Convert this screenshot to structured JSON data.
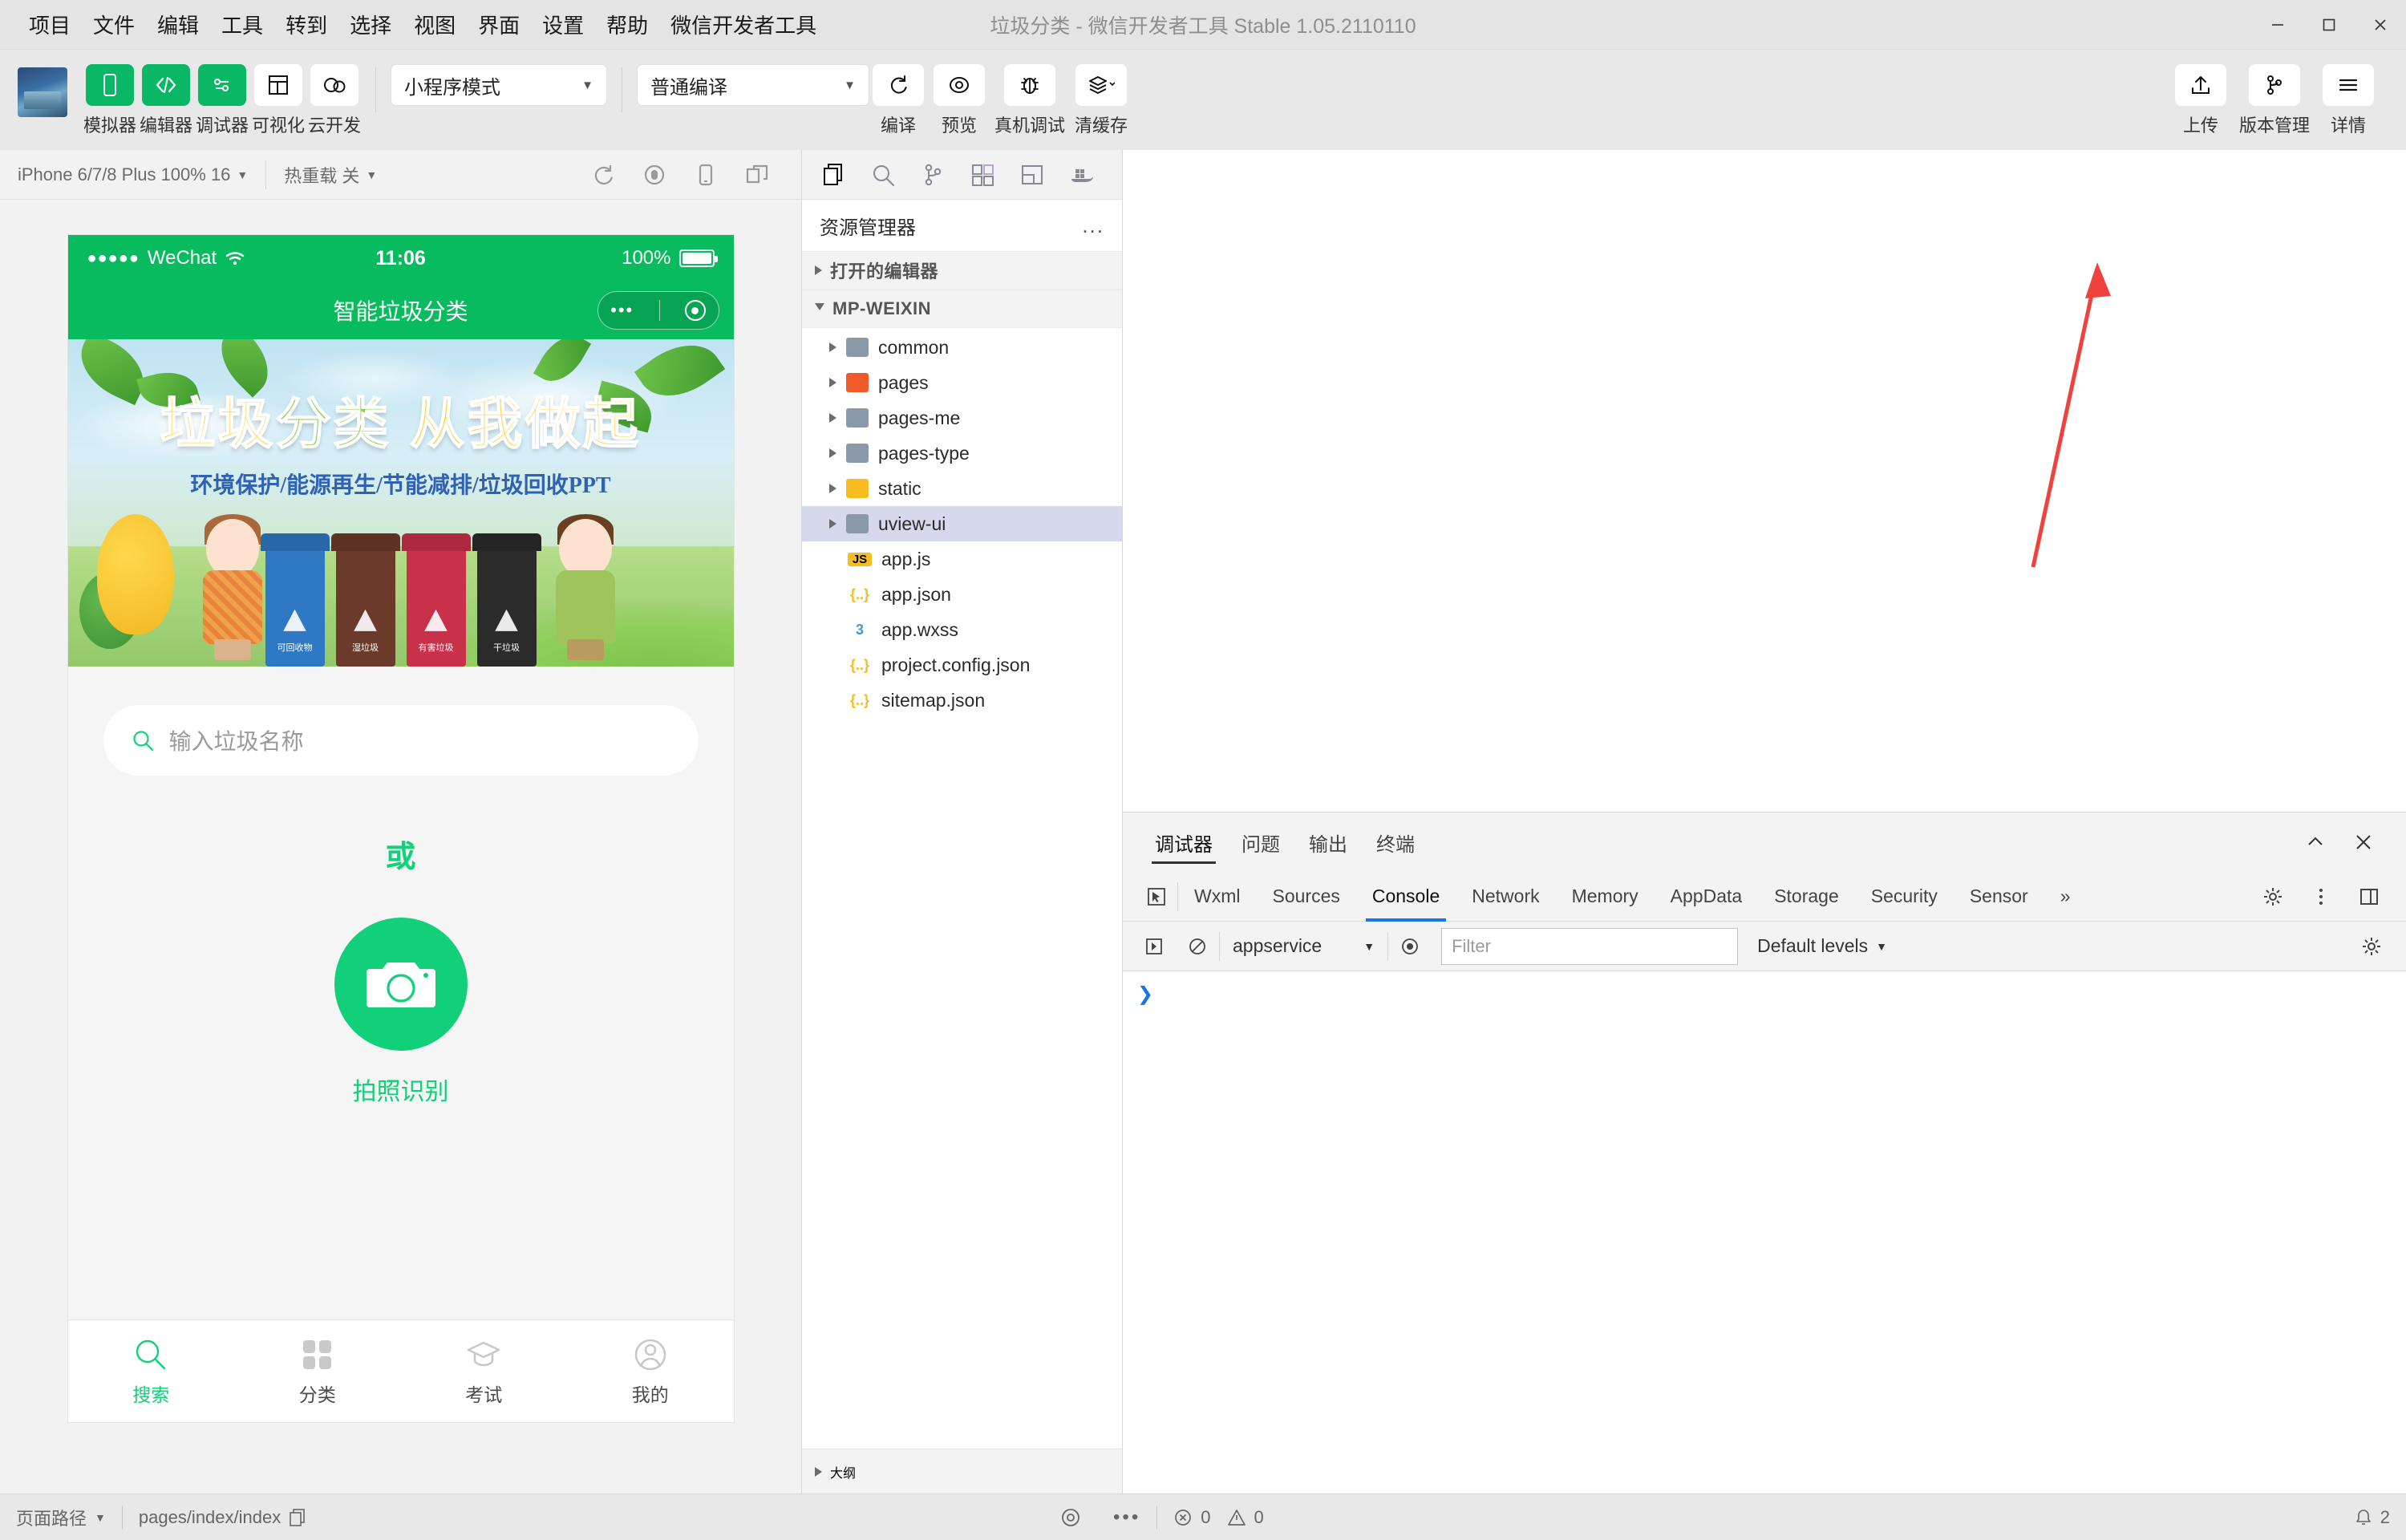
{
  "window": {
    "title": "垃圾分类 - 微信开发者工具 Stable 1.05.2110110",
    "minimize": "minimize-icon",
    "maximize": "maximize-icon",
    "close": "close-icon"
  },
  "menu": {
    "items": [
      "项目",
      "文件",
      "编辑",
      "工具",
      "转到",
      "选择",
      "视图",
      "界面",
      "设置",
      "帮助",
      "微信开发者工具"
    ]
  },
  "toolbar": {
    "panels": [
      {
        "label": "模拟器",
        "icon": "phone-icon",
        "active": true
      },
      {
        "label": "编辑器",
        "icon": "code-icon",
        "active": true
      },
      {
        "label": "调试器",
        "icon": "sliders-icon",
        "active": true
      },
      {
        "label": "可视化",
        "icon": "layout-icon",
        "active": false
      },
      {
        "label": "云开发",
        "icon": "cloud-icon",
        "active": false
      }
    ],
    "mode_select": {
      "value": "小程序模式",
      "caret": "chevron-down-icon"
    },
    "compile_select": {
      "value": "普通编译",
      "caret": "chevron-down-icon"
    },
    "actions": [
      {
        "label": "编译",
        "icon": "refresh-icon"
      },
      {
        "label": "预览",
        "icon": "eye-icon"
      },
      {
        "label": "真机调试",
        "icon": "bug-icon"
      },
      {
        "label": "清缓存",
        "icon": "layers-icon"
      }
    ],
    "right_actions": [
      {
        "label": "上传",
        "icon": "upload-icon"
      },
      {
        "label": "版本管理",
        "icon": "branch-icon"
      },
      {
        "label": "详情",
        "icon": "menu-icon"
      }
    ]
  },
  "simulator": {
    "device_select": "iPhone 6/7/8 Plus 100% 16",
    "hot_reload": "热重载 关",
    "icons": [
      "refresh-icon",
      "record-icon",
      "rotate-device-icon",
      "split-window-icon"
    ],
    "status_bar": {
      "carrier": "WeChat",
      "dots": "●●●●●",
      "time": "11:06",
      "battery_text": "100%"
    },
    "nav_title": "智能垃圾分类",
    "banner": {
      "title_part1": "垃圾",
      "title_part2": "分类",
      "title_part3": "从我做起",
      "subtitle": "环境保护/能源再生/节能减排/垃圾回收PPT",
      "bins": [
        {
          "label": "可回收物",
          "color": "#2f79c4"
        },
        {
          "label": "湿垃圾",
          "color": "#6b3a2a"
        },
        {
          "label": "有害垃圾",
          "color": "#c9304a"
        },
        {
          "label": "干垃圾",
          "color": "#2b2b2b"
        }
      ]
    },
    "search_placeholder": "输入垃圾名称",
    "search_icon": "search-icon",
    "or_text": "或",
    "camera_label": "拍照识别",
    "camera_icon": "camera-icon",
    "tabs": [
      {
        "label": "搜索",
        "icon": "search-icon",
        "active": true
      },
      {
        "label": "分类",
        "icon": "grid-icon",
        "active": false
      },
      {
        "label": "考试",
        "icon": "graduation-cap-icon",
        "active": false
      },
      {
        "label": "我的",
        "icon": "user-icon",
        "active": false
      }
    ]
  },
  "explorer": {
    "tabs": [
      "files-icon",
      "search-icon",
      "branch-icon",
      "extensions-icon",
      "layout-icon",
      "docker-icon"
    ],
    "title": "资源管理器",
    "more": "...",
    "sections": [
      {
        "name": "打开的编辑器",
        "expanded": false
      },
      {
        "name": "MP-WEIXIN",
        "expanded": true
      }
    ],
    "tree": [
      {
        "name": "common",
        "type": "folder",
        "icon_color": "grey",
        "selected": false
      },
      {
        "name": "pages",
        "type": "folder",
        "icon_color": "red",
        "selected": false
      },
      {
        "name": "pages-me",
        "type": "folder",
        "icon_color": "grey",
        "selected": false
      },
      {
        "name": "pages-type",
        "type": "folder",
        "icon_color": "grey",
        "selected": false
      },
      {
        "name": "static",
        "type": "folder",
        "icon_color": "yellow",
        "selected": false
      },
      {
        "name": "uview-ui",
        "type": "folder",
        "icon_color": "grey",
        "selected": true
      },
      {
        "name": "app.js",
        "type": "file",
        "badge": "JS",
        "badge_color": "#f5bd1f"
      },
      {
        "name": "app.json",
        "type": "file",
        "badge": "{..}",
        "badge_color": "#f5bd1f"
      },
      {
        "name": "app.wxss",
        "type": "file",
        "badge": "3",
        "badge_color": "#3b9ad9"
      },
      {
        "name": "project.config.json",
        "type": "file",
        "badge": "{..}",
        "badge_color": "#f5bd1f"
      },
      {
        "name": "sitemap.json",
        "type": "file",
        "badge": "{..}",
        "badge_color": "#f5bd1f"
      }
    ],
    "footer_section": "大纲"
  },
  "devtools": {
    "top_tabs": [
      {
        "label": "调试器",
        "active": true
      },
      {
        "label": "问题",
        "active": false
      },
      {
        "label": "输出",
        "active": false
      },
      {
        "label": "终端",
        "active": false
      }
    ],
    "top_controls": [
      "collapse-icon",
      "close-icon"
    ],
    "sub_tabs": [
      {
        "label": "Wxml",
        "active": false
      },
      {
        "label": "Sources",
        "active": false
      },
      {
        "label": "Console",
        "active": true
      },
      {
        "label": "Network",
        "active": false
      },
      {
        "label": "Memory",
        "active": false
      },
      {
        "label": "AppData",
        "active": false
      },
      {
        "label": "Storage",
        "active": false
      },
      {
        "label": "Security",
        "active": false
      },
      {
        "label": "Sensor",
        "active": false
      }
    ],
    "sub_overflow": "»",
    "inspect_icon": "inspect-icon",
    "right_icons": [
      "gear-icon",
      "kebab-icon",
      "dock-icon"
    ],
    "console": {
      "execute_icon": "execute-icon",
      "clear_icon": "clear-icon",
      "context": "appservice",
      "eye_icon": "eye-icon",
      "filter_placeholder": "Filter",
      "levels": "Default levels",
      "settings_icon": "gear-icon",
      "prompt": "❯"
    }
  },
  "statusbar": {
    "page_path_label": "页面路径",
    "page_path_value": "pages/index/index",
    "copy_icon": "copy-icon",
    "eye_icon": "eye-icon",
    "more_icon": "more-icon",
    "errors": "0",
    "warnings": "0",
    "notifications": "2"
  },
  "colors": {
    "accent_green": "#09b765",
    "wechat_green": "#09bb5f",
    "selection_blue": "#d6d9ee",
    "link_blue": "#1a73e8"
  }
}
